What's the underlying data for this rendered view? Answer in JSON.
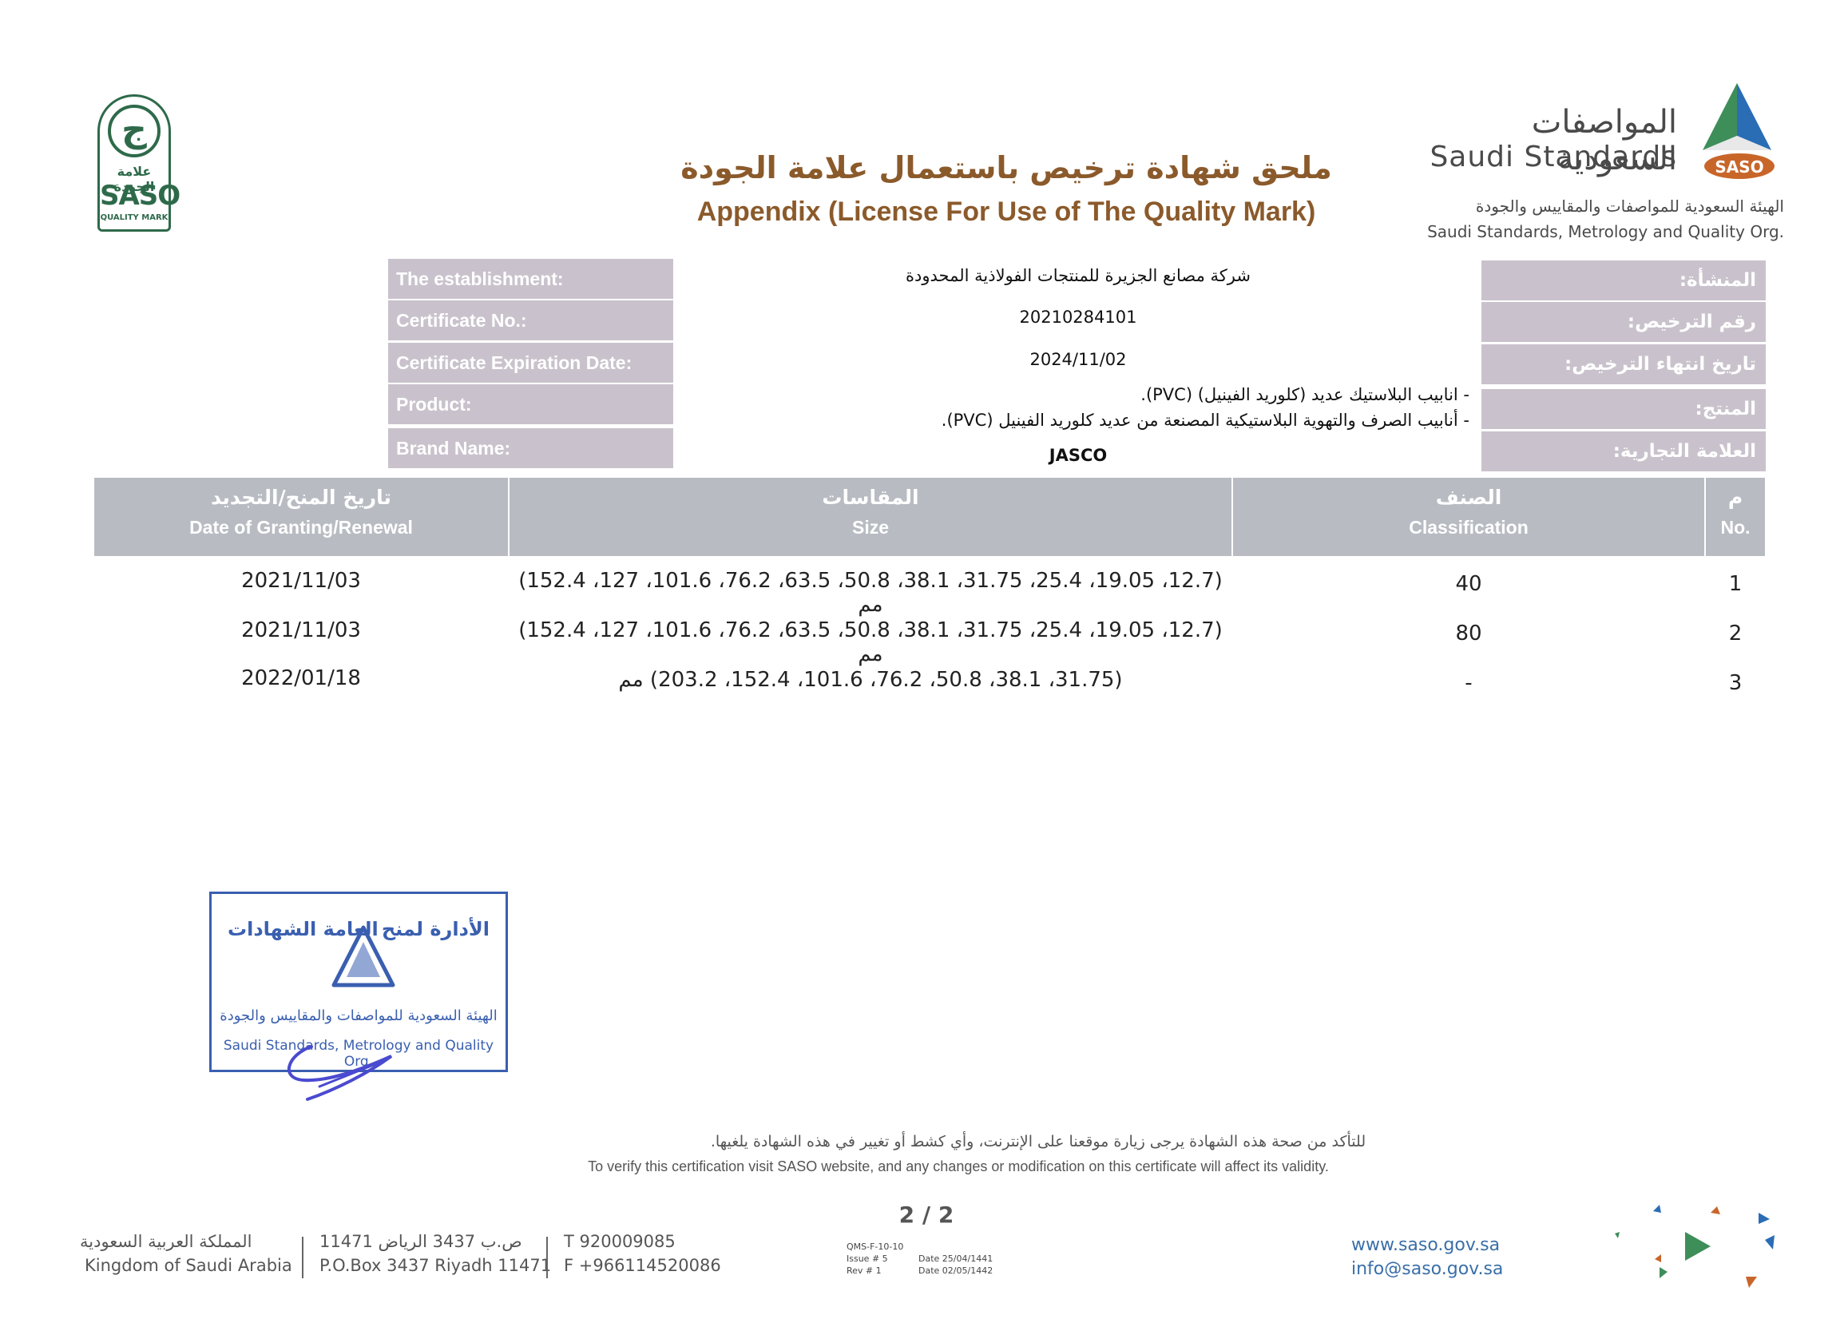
{
  "header": {
    "quality_mark": {
      "glyph": "ج",
      "ar": "علامة الجودة",
      "en": "SASO",
      "sub": "QUALITY MARK"
    },
    "title_ar": "ملحق شهادة ترخيص باستعمال علامة الجودة",
    "title_en": "Appendix (License For Use of The Quality Mark)",
    "org_logo": {
      "ar": "المواصفات السعودية",
      "en": "Saudi Standards",
      "badge": "SASO",
      "full_ar": "الهيئة السعودية للمواصفات والمقاييس والجودة",
      "full_en": "Saudi Standards, Metrology and Quality Org."
    }
  },
  "info": {
    "establishment": {
      "label_en": "The establishment:",
      "label_ar": "المنشأة:",
      "value": "شركة مصانع الجزيرة للمنتجات الفولاذية المحدودة"
    },
    "certificate_no": {
      "label_en": "Certificate No.:",
      "label_ar": "رقم الترخيص:",
      "value": "20210284101"
    },
    "expiration": {
      "label_en": "Certificate Expiration Date:",
      "label_ar": "تاريخ انتهاء الترخيص:",
      "value": "2024/11/02"
    },
    "product": {
      "label_en": "Product:",
      "label_ar": "المنتج:",
      "line1": "- انابيب البلاستيك عديد (كلوريد الفينيل) (PVC).",
      "line2": "- أنابيب الصرف والتهوية البلاستيكية المصنعة من عديد كلوريد الفينيل (PVC)."
    },
    "brand": {
      "label_en": "Brand Name:",
      "label_ar": "العلامة التجارية:",
      "value": "JASCO"
    }
  },
  "table": {
    "headers": {
      "no": {
        "ar": "م",
        "en": "No."
      },
      "classification": {
        "ar": "الصنف",
        "en": "Classification"
      },
      "size": {
        "ar": "المقاسات",
        "en": "Size"
      },
      "date": {
        "ar": "تاريخ المنح/التجديد",
        "en": "Date of Granting/Renewal"
      }
    },
    "rows": [
      {
        "no": "1",
        "classification": "40",
        "size": "(12.7، 19.05، 25.4، 31.75، 38.1، 50.8، 63.5، 76.2، 101.6، 127، 152.4) مم",
        "date": "2021/11/03"
      },
      {
        "no": "2",
        "classification": "80",
        "size": "(12.7، 19.05، 25.4، 31.75، 38.1، 50.8، 63.5، 76.2، 101.6، 127، 152.4) مم",
        "date": "2021/11/03"
      },
      {
        "no": "3",
        "classification": "-",
        "size": "(31.75، 38.1، 50.8، 76.2، 101.6، 152.4، 203.2) مم",
        "date": "2022/01/18"
      }
    ]
  },
  "stamp": {
    "ar_left": "العامة الشهادات",
    "ar_right": "الأدارة لمنح",
    "ar_org": "الهيئة السعودية للمواصفات والمقاييس والجودة",
    "en_org": "Saudi Standards, Metrology and Quality Org."
  },
  "footer": {
    "verify_ar": "للتأكد من صحة هذه الشهادة يرجى زيارة موقعنا على الإنترنت، وأي كشط أو تغيير في هذه الشهادة يلغيها.",
    "verify_en": "To verify this certification visit SASO website, and any changes or modification on this certificate will affect its validity.",
    "page": "2 / 2",
    "country_ar": "المملكة العربية السعودية",
    "country_en": "Kingdom of Saudi Arabia",
    "pobox_ar": "ص.ب  3437  الرياض  11471",
    "pobox_en": "P.O.Box 3437  Riyadh 11471",
    "phone": "T   920009085",
    "fax": "F  +966114520086",
    "qms_code": "QMS-F-10-10",
    "issue": "Issue # 5",
    "rev": "Rev #  1",
    "date1": "Date 25/04/1441",
    "date2": "Date 02/05/1442",
    "website": "www.saso.gov.sa",
    "email": "info@saso.gov.sa"
  },
  "colors": {
    "title": "#8b5a2b",
    "label_bg": "#c9c2cc",
    "table_header_bg": "#b8bcc2",
    "stamp": "#3a5fb0",
    "link": "#3a6fa8"
  }
}
